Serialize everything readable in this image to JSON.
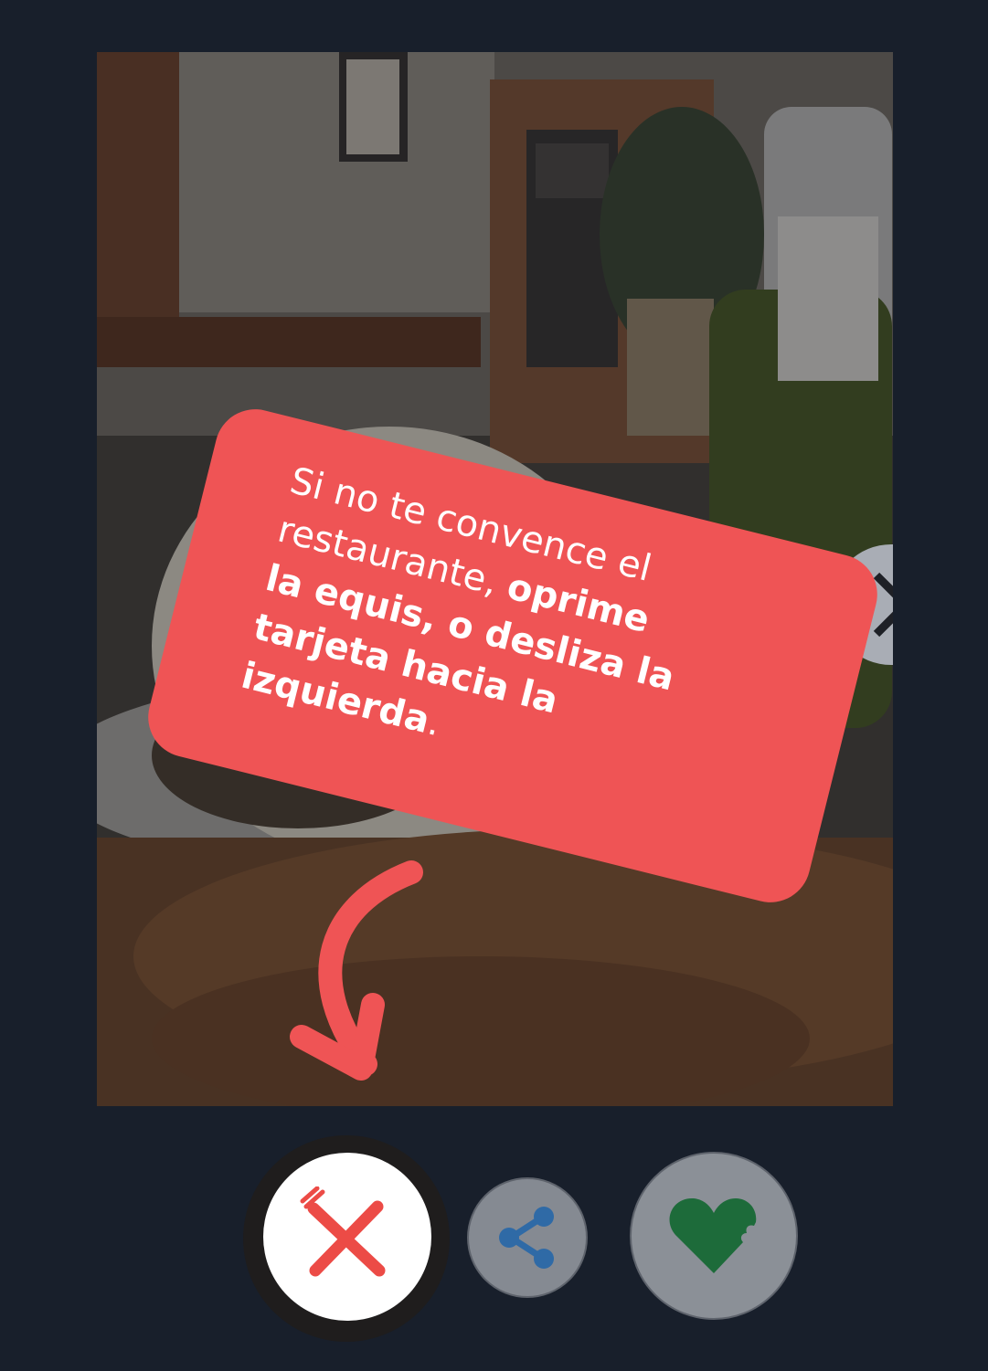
{
  "tutorial": {
    "line1": "Si no te convence el",
    "line2_light": "restaurante, ",
    "line2_bold": "oprime",
    "line3": "la equis, o desliza la",
    "line4_bold": "tarjeta hacia la izquierda",
    "line4_end": "."
  },
  "actions": {
    "dislike": {
      "icon": "fork-knife-cross-icon",
      "color": "#ec4b46"
    },
    "share": {
      "icon": "share-icon",
      "color": "#2f6aa6"
    },
    "like": {
      "icon": "bitten-heart-icon",
      "color": "#1d6b3a"
    }
  },
  "colors": {
    "background": "#181f2b",
    "tooltip": "#ef5455",
    "arrow": "#ef5455"
  }
}
